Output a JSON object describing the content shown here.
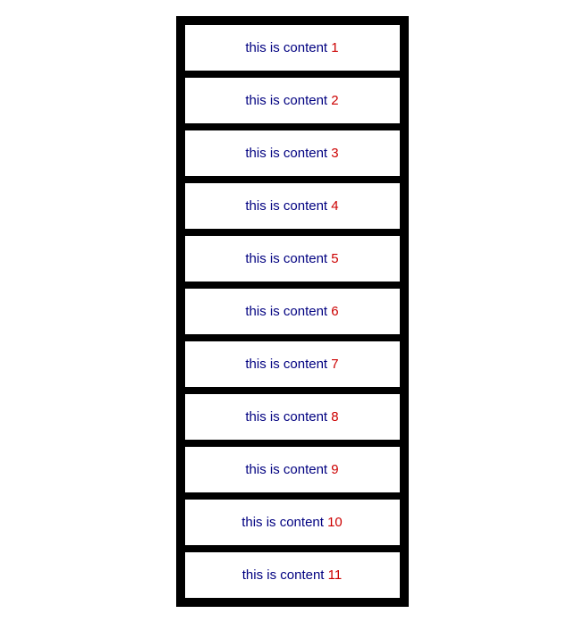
{
  "items": [
    {
      "id": 1,
      "prefix": "this is content ",
      "number": "1"
    },
    {
      "id": 2,
      "prefix": "this is content ",
      "number": "2"
    },
    {
      "id": 3,
      "prefix": "this is content ",
      "number": "3"
    },
    {
      "id": 4,
      "prefix": "this is content ",
      "number": "4"
    },
    {
      "id": 5,
      "prefix": "this is content ",
      "number": "5"
    },
    {
      "id": 6,
      "prefix": "this is content ",
      "number": "6"
    },
    {
      "id": 7,
      "prefix": "this is content ",
      "number": "7"
    },
    {
      "id": 8,
      "prefix": "this is content ",
      "number": "8"
    },
    {
      "id": 9,
      "prefix": "this is content ",
      "number": "9"
    },
    {
      "id": 10,
      "prefix": "this is content ",
      "number": "10"
    },
    {
      "id": 11,
      "prefix": "this is content ",
      "number": "11"
    }
  ]
}
